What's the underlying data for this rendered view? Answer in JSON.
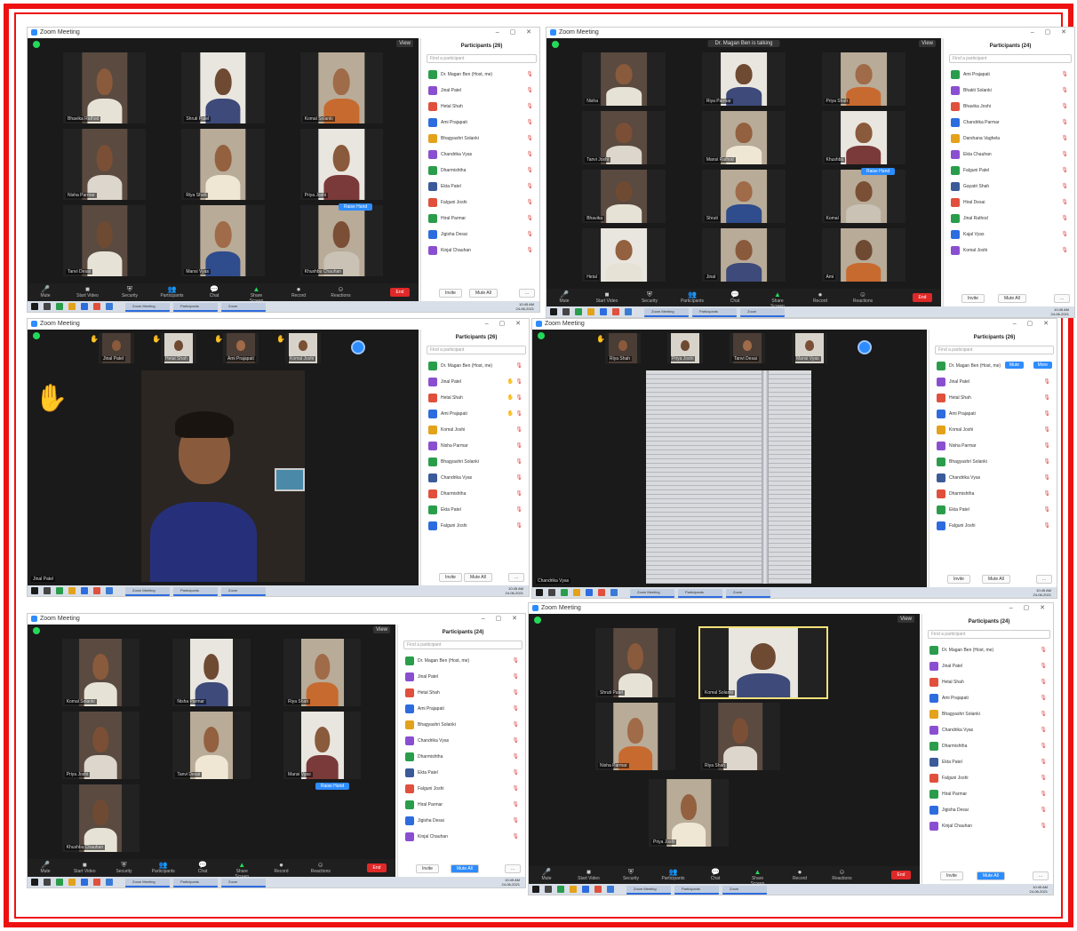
{
  "screens": [
    {
      "id": "a",
      "window_title": "Zoom Meeting",
      "view_label": "View",
      "speaker": "",
      "participants_title": "Participants (26)",
      "search_placeholder": "Find a participant",
      "participants": [
        "Dr. Magan Ben (Host, me)",
        "Jinal Patel",
        "Hetal Shah",
        "Ami Prajapati",
        "Bhagyashri Solanki",
        "Chandrika Vyas",
        "Dharmishtha",
        "Ekta Patel",
        "Falguni Joshi",
        "Hiral Parmar",
        "Jigisha Desai",
        "Kinjal Chauhan"
      ],
      "footer": [
        "Invite",
        "Mute All",
        "..."
      ],
      "tiles": [
        "Bhavika Rathod",
        "Shruti Patel",
        "Komal Solanki",
        "Nisha Parmar",
        "Riya Shah",
        "Priya Joshi",
        "Tanvi Desai",
        "Mansi Vyas",
        "Khushbu Chauhan"
      ],
      "popup": "Raise Hand",
      "controls": [
        "Mute",
        "Start Video",
        "Security",
        "Participants",
        "Chat",
        "Share Screen",
        "Record",
        "Reactions"
      ],
      "end_label": "End"
    },
    {
      "id": "b",
      "window_title": "Zoom Meeting",
      "view_label": "View",
      "speaker": "Dr. Magan Ben is talking",
      "participants_title": "Participants (24)",
      "search_placeholder": "Find a participant",
      "participants": [
        "Ami Prajapati",
        "Bhakti Solanki",
        "Bhavika Joshi",
        "Chandrika Parmar",
        "Darshana Vaghela",
        "Ekta Chauhan",
        "Falguni Patel",
        "Gayatri Shah",
        "Hiral Desai",
        "Jinal Rathod",
        "Kajal Vyas",
        "Komal Joshi"
      ],
      "footer": [
        "Invite",
        "Mute All",
        "..."
      ],
      "tiles": [
        "Nisha",
        "Riya Parmar",
        "Priya Shah",
        "Tanvi Joshi",
        "Mansi Rathod",
        "Khushbu",
        "Bhavika",
        "Shruti",
        "Komal",
        "Hetal",
        "Jinal",
        "Ami"
      ],
      "popup": "Raise Hand",
      "controls": [
        "Mute",
        "Start Video",
        "Security",
        "Participants",
        "Chat",
        "Share Screen",
        "Record",
        "Reactions"
      ],
      "end_label": "End"
    },
    {
      "id": "c",
      "window_title": "Zoom Meeting",
      "participants_title": "Participants (26)",
      "search_placeholder": "Find a participant",
      "participants": [
        "Dr. Magan Ben (Host, me)",
        "Jinal Patel",
        "Hetal Shah",
        "Ami Prajapati",
        "Komal Joshi",
        "Nisha Parmar",
        "Bhagyashri Solanki",
        "Chandrika Vyas",
        "Dharmishtha",
        "Ekta Patel",
        "Falguni Joshi"
      ],
      "footer": [
        "Invite",
        "Mute All",
        "..."
      ],
      "strip": [
        "Jinal Patel",
        "Hetal Shah",
        "Ami Prajapati",
        "Komal Joshi"
      ],
      "spotlight_name": "Jinal Patel"
    },
    {
      "id": "d",
      "window_title": "Zoom Meeting",
      "participants_title": "Participants (26)",
      "search_placeholder": "Find a participant",
      "participants": [
        "Dr. Magan Ben (Host, me)",
        "Jinal Patel",
        "Hetal Shah",
        "Ami Prajapati",
        "Komal Joshi",
        "Nisha Parmar",
        "Bhagyashri Solanki",
        "Chandrika Vyas",
        "Dharmishtha",
        "Ekta Patel",
        "Falguni Joshi"
      ],
      "footer": [
        "Invite",
        "Mute All",
        "..."
      ],
      "strip": [
        "Riya Shah",
        "Priya Joshi",
        "Tanvi Desai",
        "Mansi Vyas"
      ],
      "spotlight_name": "Chandrika Vyas",
      "row_buttons": [
        "Mute",
        "More"
      ]
    },
    {
      "id": "e",
      "window_title": "Zoom Meeting",
      "view_label": "View",
      "participants_title": "Participants (24)",
      "search_placeholder": "Find a participant",
      "participants": [
        "Dr. Magan Ben (Host, me)",
        "Jinal Patel",
        "Hetal Shah",
        "Ami Prajapati",
        "Bhagyashri Solanki",
        "Chandrika Vyas",
        "Dharmishtha",
        "Ekta Patel",
        "Falguni Joshi",
        "Hiral Parmar",
        "Jigisha Desai",
        "Kinjal Chauhan"
      ],
      "footer": [
        "Invite",
        "Mute All",
        "..."
      ],
      "tiles": [
        "Komal Solanki",
        "Nisha Parmar",
        "Riya Shah",
        "Priya Joshi",
        "Tanvi Desai",
        "Mansi Vyas",
        "Khushbu Chauhan"
      ],
      "popup": "Raise Hand",
      "controls": [
        "Mute",
        "Start Video",
        "Security",
        "Participants",
        "Chat",
        "Share Screen",
        "Record",
        "Reactions"
      ],
      "end_label": "End"
    },
    {
      "id": "f",
      "window_title": "Zoom Meeting",
      "view_label": "View",
      "participants_title": "Participants (24)",
      "search_placeholder": "Find a participant",
      "participants": [
        "Dr. Magan Ben (Host, me)",
        "Jinal Patel",
        "Hetal Shah",
        "Ami Prajapati",
        "Bhagyashri Solanki",
        "Chandrika Vyas",
        "Dharmishtha",
        "Ekta Patel",
        "Falguni Joshi",
        "Hiral Parmar",
        "Jigisha Desai",
        "Kinjal Chauhan"
      ],
      "footer": [
        "Invite",
        "Mute All",
        "..."
      ],
      "tiles": [
        "Shruti Patel",
        "Komal Solanki",
        "Nisha Parmar",
        "Riya Shah",
        "Priya Joshi"
      ],
      "controls": [
        "Mute",
        "Start Video",
        "Security",
        "Participants",
        "Chat",
        "Share Screen",
        "Record",
        "Reactions"
      ],
      "end_label": "End"
    }
  ],
  "taskbar": {
    "windows": [
      "Zoom Meeting",
      "Participants",
      "Zoom"
    ],
    "time": "10:45 AM",
    "date": "24-06-2021"
  },
  "colors": {
    "frame": "#ee1111",
    "accent": "#2d8cff",
    "share": "#23d959",
    "end": "#e02828"
  }
}
